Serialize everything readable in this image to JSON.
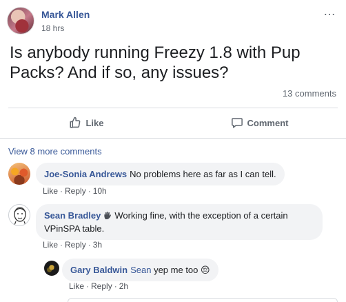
{
  "post": {
    "author": "Mark Allen",
    "time": "18 hrs",
    "text": "Is anybody running Freezy 1.8 with Pup Packs? And if so, any issues?",
    "comments_count": "13 comments",
    "more_icon": "…"
  },
  "actions": {
    "like_label": "Like",
    "comment_label": "Comment"
  },
  "view_more": "View 8 more comments",
  "comments": [
    {
      "name": "Joe-Sonia Andrews",
      "text": "No problems here as far as I can tell.",
      "like": "Like",
      "reply": "Reply",
      "time": "10h"
    },
    {
      "name": "Sean Bradley",
      "badge_icon": "hand-wave-icon",
      "text": "Working fine, with the exception of a certain VPinSPA table.",
      "like": "Like",
      "reply": "Reply",
      "time": "3h"
    },
    {
      "name": "Gary Baldwin",
      "mention": "Sean",
      "text": "yep me too",
      "emoji": "😔",
      "like": "Like",
      "reply": "Reply",
      "time": "2h"
    }
  ],
  "colors": {
    "link": "#385898",
    "muted": "#606770",
    "bubble": "#f2f3f5"
  }
}
